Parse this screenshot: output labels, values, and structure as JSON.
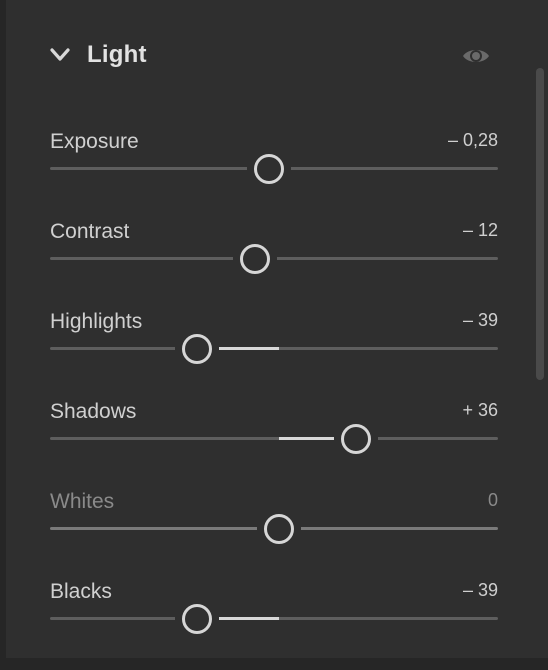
{
  "panel": {
    "title": "Light",
    "collapse_icon": "chevron-down-icon",
    "visibility_icon": "eye-icon"
  },
  "sliders": [
    {
      "label": "Exposure",
      "value": "– 0,28",
      "position": 0.488,
      "muted": false
    },
    {
      "label": "Contrast",
      "value": "– 12",
      "position": 0.457,
      "muted": false
    },
    {
      "label": "Highlights",
      "value": "– 39",
      "position": 0.328,
      "muted": false
    },
    {
      "label": "Shadows",
      "value": "+ 36",
      "position": 0.684,
      "muted": false
    },
    {
      "label": "Whites",
      "value": "0",
      "position": 0.512,
      "muted": true
    },
    {
      "label": "Blacks",
      "value": "– 39",
      "position": 0.328,
      "muted": false
    }
  ],
  "colors": {
    "panel_bg": "#2f2f2f",
    "text": "#d0d0d0",
    "track": "#5e5e5e",
    "thumb": "#d6d6d6"
  }
}
